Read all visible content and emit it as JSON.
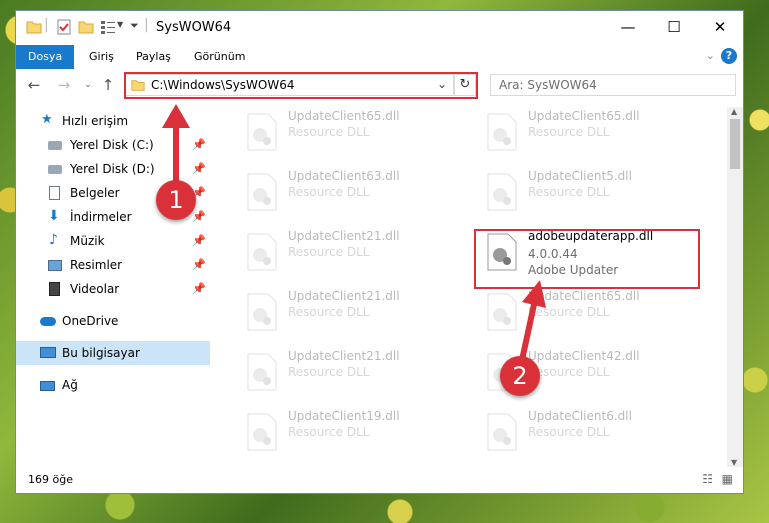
{
  "window": {
    "title": "SysWOW64",
    "minimize": "—",
    "maximize": "☐",
    "close": "✕"
  },
  "ribbon": {
    "tabs": [
      {
        "label": "Dosya"
      },
      {
        "label": "Giriş"
      },
      {
        "label": "Paylaş"
      },
      {
        "label": "Görünüm"
      }
    ],
    "help": "?"
  },
  "address": {
    "path": "C:\\Windows\\SysWOW64",
    "search_placeholder": "Ara: SysWOW64"
  },
  "sidebar": {
    "items": [
      {
        "label": "Hızlı erişim",
        "icon": "star-icon"
      },
      {
        "label": "Yerel Disk (C:)",
        "icon": "drive-icon"
      },
      {
        "label": "Yerel Disk (D:)",
        "icon": "drive-icon"
      },
      {
        "label": "Belgeler",
        "icon": "documents-icon"
      },
      {
        "label": "İndirmeler",
        "icon": "download-icon"
      },
      {
        "label": "Müzik",
        "icon": "music-icon"
      },
      {
        "label": "Resimler",
        "icon": "pictures-icon"
      },
      {
        "label": "Videolar",
        "icon": "videos-icon"
      },
      {
        "label": "OneDrive",
        "icon": "cloud-icon"
      },
      {
        "label": "Bu bilgisayar",
        "icon": "computer-icon"
      },
      {
        "label": "Ağ",
        "icon": "network-icon"
      }
    ]
  },
  "files": {
    "left": [
      {
        "name": "UpdateClient65.dll",
        "type": "Resource DLL"
      },
      {
        "name": "UpdateClient63.dll",
        "type": "Resource DLL"
      },
      {
        "name": "UpdateClient21.dll",
        "type": "Resource DLL"
      },
      {
        "name": "UpdateClient21.dll",
        "type": "Resource DLL"
      },
      {
        "name": "UpdateClient21.dll",
        "type": "Resource DLL"
      },
      {
        "name": "UpdateClient19.dll",
        "type": "Resource DLL"
      }
    ],
    "right": [
      {
        "name": "UpdateClient65.dll",
        "type": "Resource DLL"
      },
      {
        "name": "UpdateClient5.dll",
        "type": "Resource DLL"
      },
      {
        "name": "adobeupdaterapp.dll",
        "version": "4.0.0.44",
        "type": "Adobe Updater"
      },
      {
        "name": "UpdateClient65.dll",
        "type": "Resource DLL"
      },
      {
        "name": "UpdateClient42.dll",
        "type": "Resource DLL"
      },
      {
        "name": "UpdateClient6.dll",
        "type": "Resource DLL"
      }
    ]
  },
  "status": {
    "count": "169 öğe"
  },
  "callouts": {
    "one": "1",
    "two": "2"
  }
}
